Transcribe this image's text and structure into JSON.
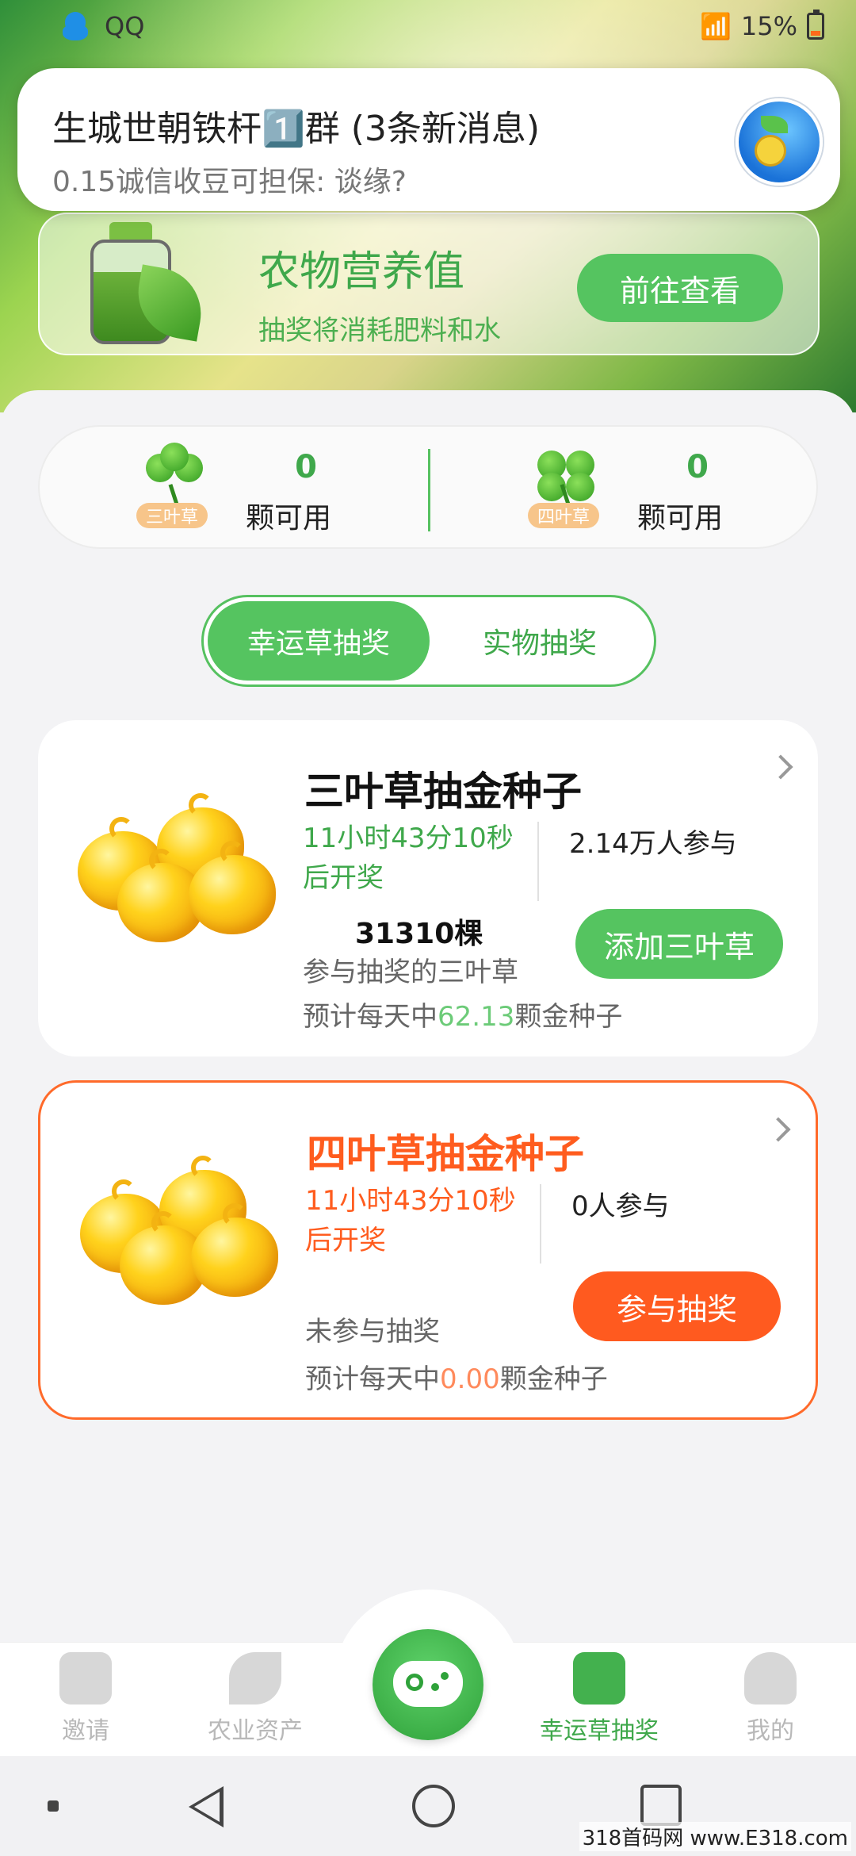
{
  "status_bar": {
    "app_name": "QQ",
    "battery": "15%"
  },
  "notification": {
    "title": "生城世朝铁杆1️⃣群 (3条新消息)",
    "message": "0.15诚信收豆可担保: 谈缘?"
  },
  "nutrition": {
    "title": "农物营养值",
    "subtitle": "抽奖将消耗肥料和水",
    "button": "前往查看"
  },
  "clovers": [
    {
      "tag": "三叶草",
      "count": "0",
      "label": "颗可用"
    },
    {
      "tag": "四叶草",
      "count": "0",
      "label": "颗可用"
    }
  ],
  "tabs": {
    "active": "幸运草抽奖",
    "inactive": "实物抽奖"
  },
  "draws": [
    {
      "title": "三叶草抽金种子",
      "countdown": "11小时43分10秒后开奖",
      "participants": "2.14万人参与",
      "clover_total": "31310棵",
      "clover_total_label": "参与抽奖的三叶草",
      "button": "添加三叶草",
      "daily_prefix": "预计每天中",
      "daily_value": "62.13",
      "daily_suffix": "颗金种子"
    },
    {
      "title": "四叶草抽金种子",
      "countdown": "11小时43分10秒后开奖",
      "participants": "0人参与",
      "status": "未参与抽奖",
      "button": "参与抽奖",
      "daily_prefix": "预计每天中",
      "daily_value": "0.00",
      "daily_suffix": "颗金种子"
    }
  ],
  "tabbar": {
    "items": [
      {
        "label": "邀请",
        "icon": "mail-icon"
      },
      {
        "label": "农业资产",
        "icon": "plant-icon"
      },
      {
        "label": "",
        "icon": "gamepad-icon"
      },
      {
        "label": "幸运草抽奖",
        "icon": "gift-icon"
      },
      {
        "label": "我的",
        "icon": "profile-icon"
      }
    ]
  },
  "watermark": "318首码网 www.E318.com",
  "colors": {
    "green": "#55c460",
    "orange": "#ff5a1f"
  }
}
